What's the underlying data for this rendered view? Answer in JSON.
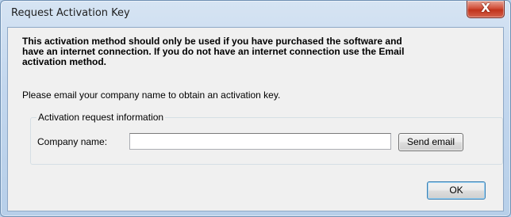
{
  "window": {
    "title": "Request Activation Key",
    "close_glyph": "X",
    "close_icon": "close-icon"
  },
  "content": {
    "warning_line1": "This activation method should only be used if you have purchased the software and",
    "warning_line2": "have an internet connection.  If you do not have an internet connection use the Email",
    "warning_line3": "activation method.",
    "instruction": "Please email your company name to obtain an activation key."
  },
  "group": {
    "legend": "Activation request information",
    "company_label": "Company name:",
    "company_value": "",
    "send_label": "Send email"
  },
  "footer": {
    "ok_label": "OK"
  },
  "colors": {
    "window_frame": "#c3d7ee",
    "client_bg": "#f0f0f0",
    "close_red": "#c1331b"
  }
}
